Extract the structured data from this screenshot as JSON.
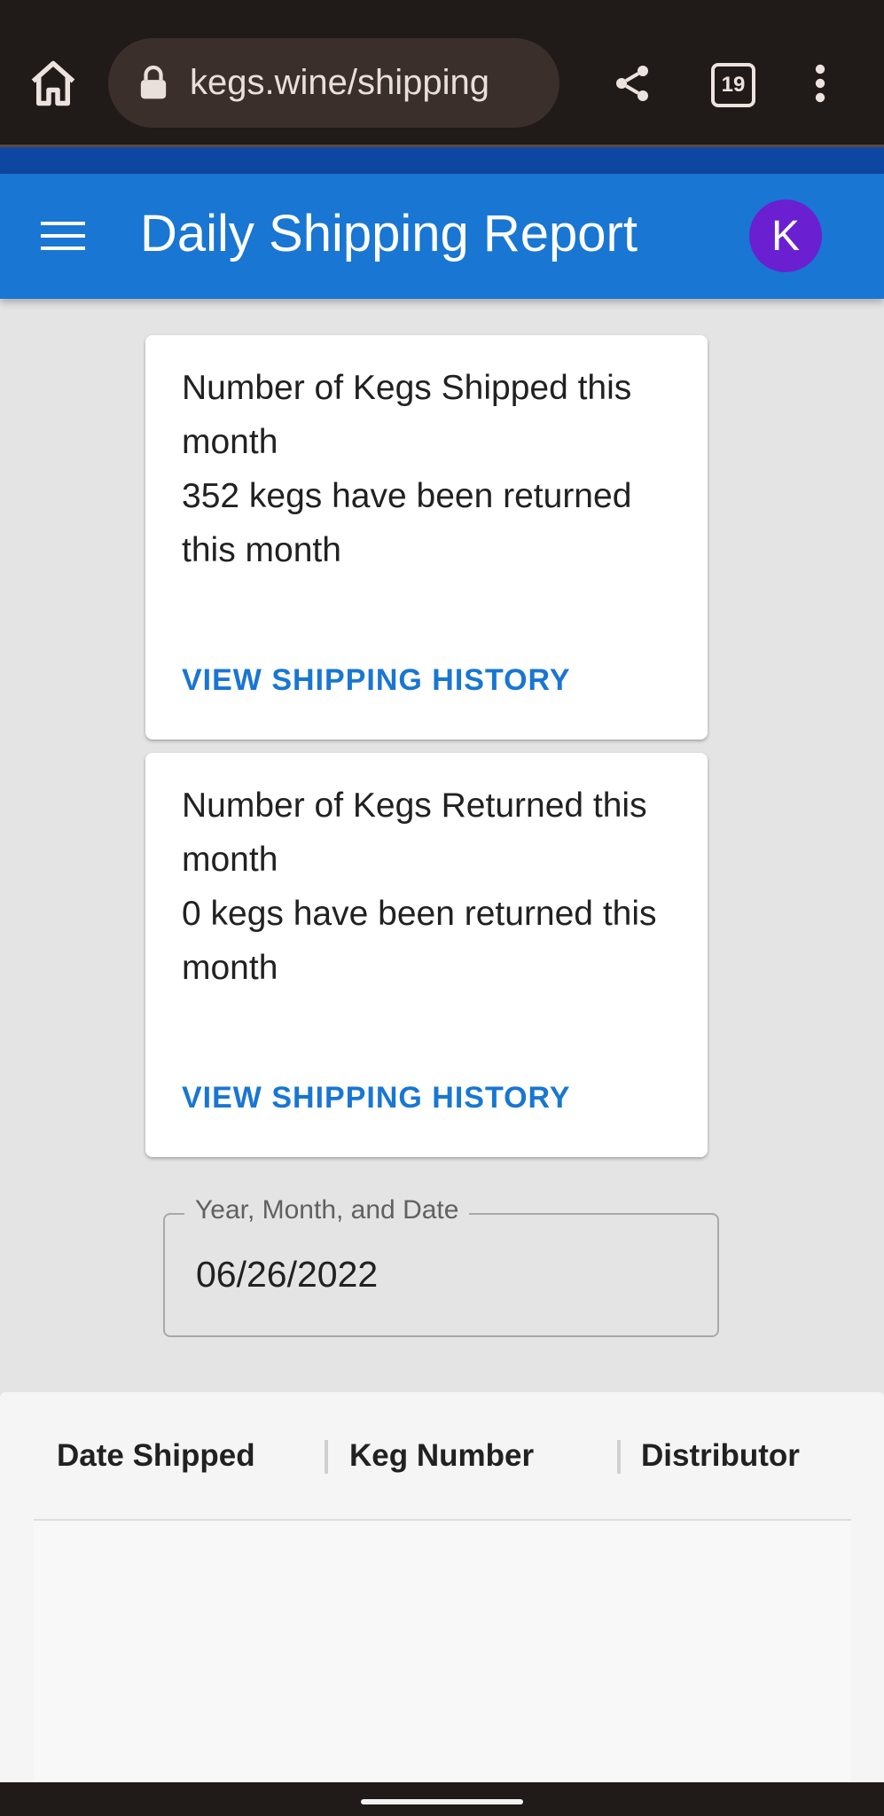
{
  "browser": {
    "url": "kegs.wine/shipping",
    "tab_count": "19"
  },
  "app_bar": {
    "title": "Daily Shipping Report",
    "avatar_letter": "K",
    "colors": {
      "primary": "#1976d2",
      "avatar": "#6a1fd1"
    }
  },
  "cards": [
    {
      "title": "Number of Kegs Shipped this month",
      "description": "352 kegs have been returned this month",
      "action": "VIEW SHIPPING HISTORY"
    },
    {
      "title": "Number of Kegs Returned this month",
      "description": "0 kegs have been returned this month",
      "action": "VIEW SHIPPING HISTORY"
    }
  ],
  "date_field": {
    "label": "Year, Month, and Date",
    "value": "06/26/2022"
  },
  "table": {
    "columns": [
      "Date Shipped",
      "Keg Number",
      "Distributor"
    ],
    "rows": []
  }
}
